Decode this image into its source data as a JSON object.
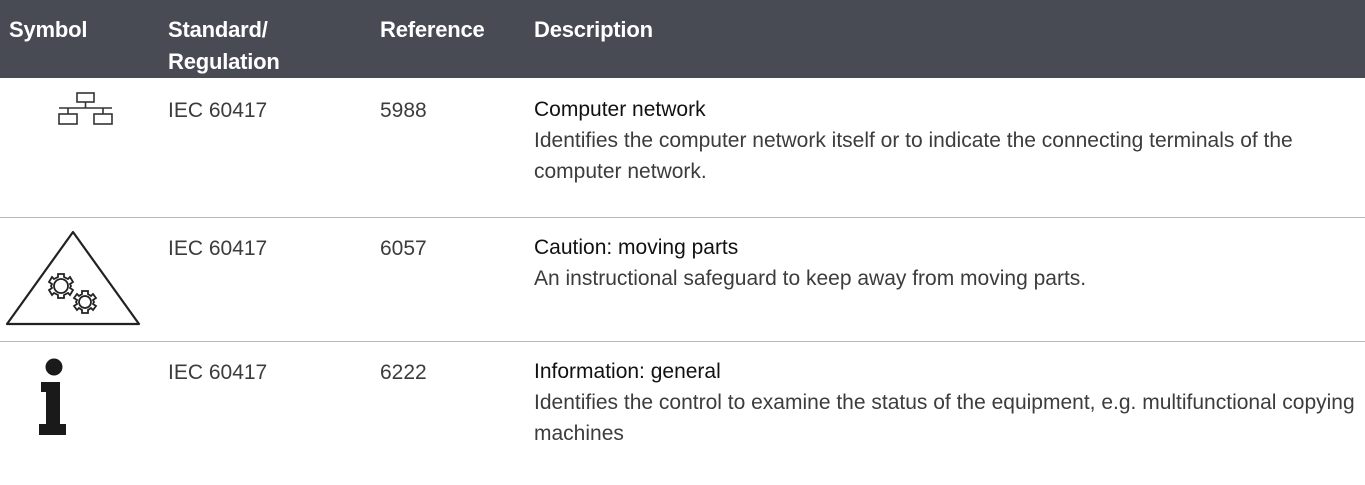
{
  "table": {
    "headers": {
      "symbol": "Symbol",
      "standard_line1": "Standard/",
      "standard_line2": "Regulation",
      "reference": "Reference",
      "description": "Description"
    },
    "rows": [
      {
        "icon": "computer-network-icon",
        "standard": "IEC 60417",
        "reference": "5988",
        "title": "Computer network",
        "text": "Identifies the computer network itself or to indicate the connecting terminals of the computer network."
      },
      {
        "icon": "caution-moving-parts-icon",
        "standard": "IEC 60417",
        "reference": "6057",
        "title": "Caution: moving parts",
        "text": "An instructional safeguard to keep away from moving parts."
      },
      {
        "icon": "information-icon",
        "standard": "IEC 60417",
        "reference": "6222",
        "title": "Information: general",
        "text": "Identifies the control to examine the status of the equipment, e.g. multifunctional copying machines"
      }
    ]
  },
  "colors": {
    "header_bg": "#484a54",
    "header_text": "#ffffff",
    "row_divider": "#b8b8b8"
  }
}
